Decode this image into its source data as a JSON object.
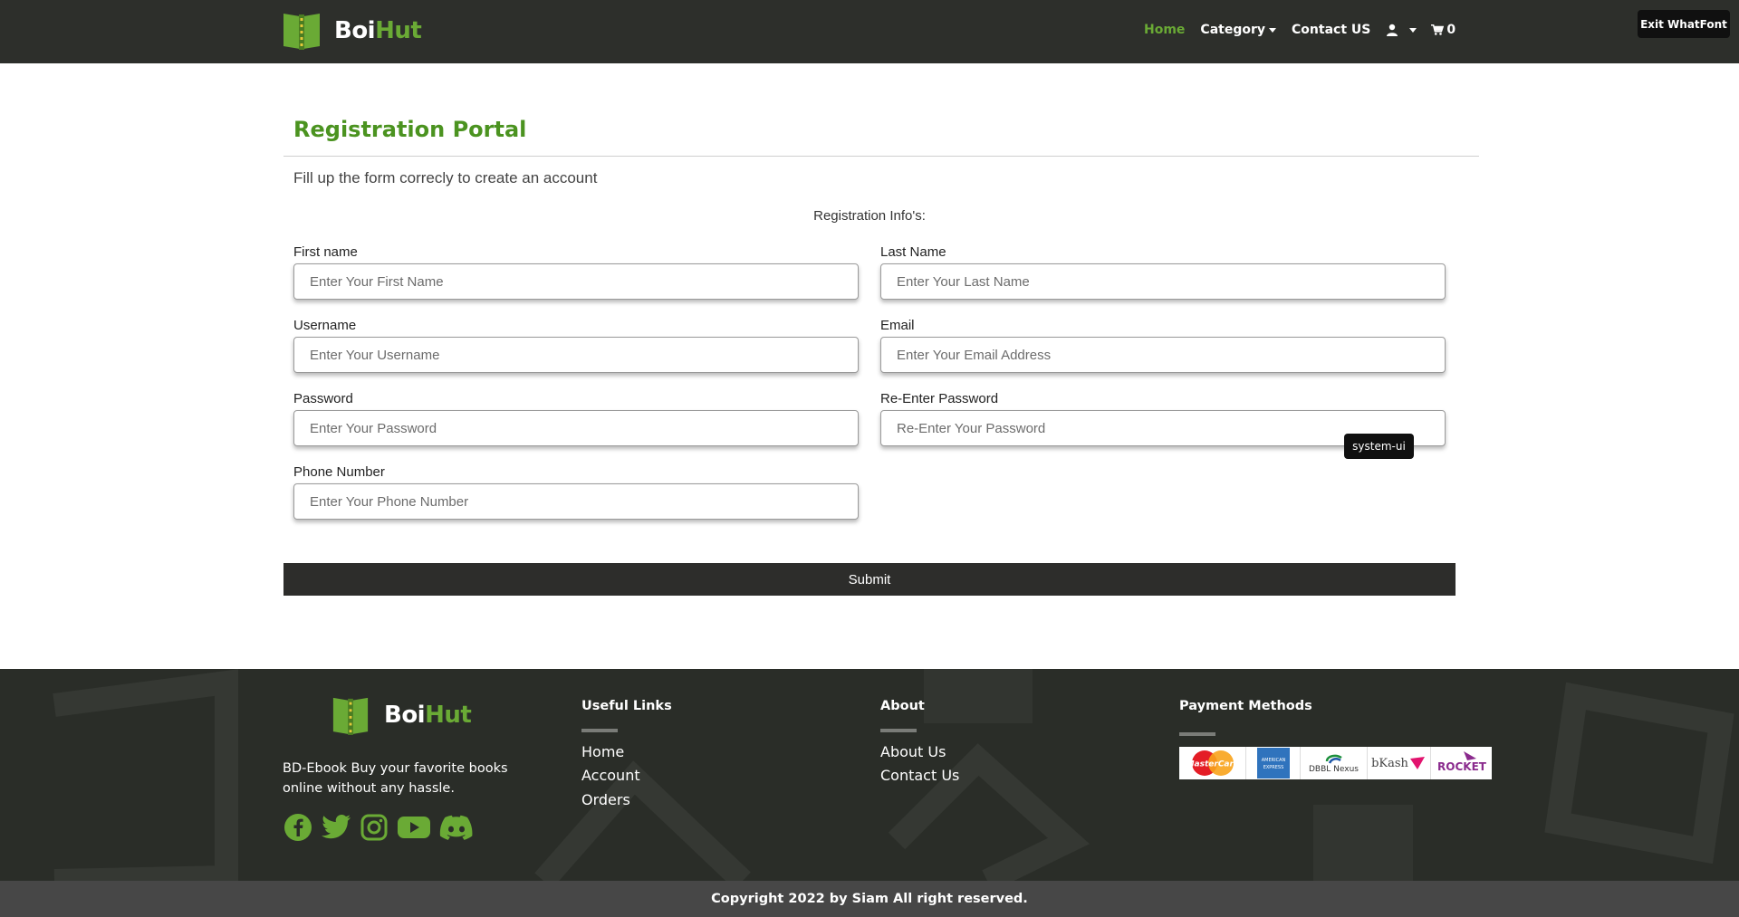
{
  "brand": {
    "name_part1": "Boi",
    "name_part2": "Hut"
  },
  "nav": {
    "home": "Home",
    "category": "Category",
    "contact": "Contact US",
    "cart_count": "0"
  },
  "exit_button": "Exit WhatFont",
  "tooltip": "system-ui",
  "form": {
    "title": "Registration Portal",
    "subtitle": "Fill up the form correcly to create an account",
    "section_label": "Registration Info's:",
    "fields": {
      "first_name": {
        "label": "First name",
        "placeholder": "Enter Your First Name"
      },
      "last_name": {
        "label": "Last Name",
        "placeholder": "Enter Your Last Name"
      },
      "username": {
        "label": "Username",
        "placeholder": "Enter Your Username"
      },
      "email": {
        "label": "Email",
        "placeholder": "Enter Your Email Address"
      },
      "password": {
        "label": "Password",
        "placeholder": "Enter Your Password"
      },
      "re_password": {
        "label": "Re-Enter Password",
        "placeholder": "Re-Enter Your Password"
      },
      "phone": {
        "label": "Phone Number",
        "placeholder": "Enter Your Phone Number"
      }
    },
    "submit": "Submit"
  },
  "footer": {
    "description": "BD-Ebook Buy your favorite books online without any hassle.",
    "socials": [
      "facebook-icon",
      "twitter-icon",
      "instagram-icon",
      "youtube-icon",
      "discord-icon"
    ],
    "useful_links": {
      "heading": "Useful Links",
      "items": [
        "Home",
        "Account",
        "Orders"
      ]
    },
    "about": {
      "heading": "About",
      "items": [
        "About Us",
        "Contact Us"
      ]
    },
    "payment": {
      "heading": "Payment Methods",
      "logos": [
        "MasterCard",
        "AMERICAN EXPRESS",
        "DBBL Nexus",
        "bKash",
        "ROCKET"
      ]
    },
    "copyright": "Copyright 2022 by Siam All right reserved."
  },
  "colors": {
    "accent_green": "#6aaa35",
    "title_green": "#4b9320",
    "navbar_bg": "#2d2f2b",
    "footer_bg": "#2a2d28"
  }
}
